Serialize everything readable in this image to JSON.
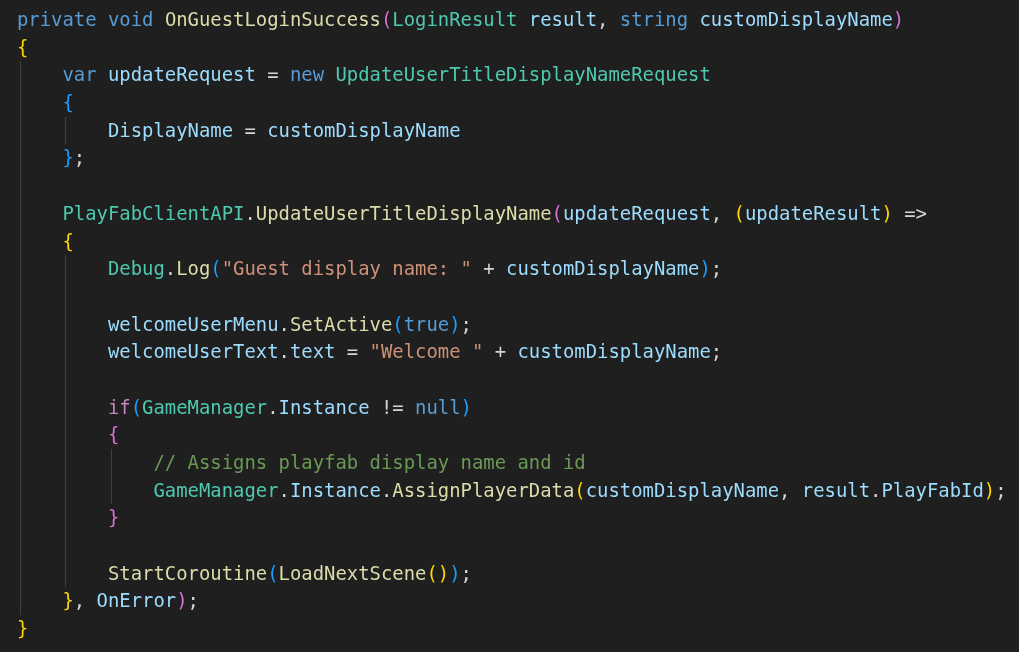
{
  "editor": {
    "lines": [
      {
        "kind": "code",
        "tokens": [
          {
            "text": "private ",
            "kind": "keyword"
          },
          {
            "text": "void ",
            "kind": "keyword"
          },
          {
            "text": "OnGuestLoginSuccess",
            "kind": "function"
          },
          {
            "text": "(",
            "kind": "bracket",
            "color": "#da70d6"
          },
          {
            "text": "LoginResult ",
            "kind": "type"
          },
          {
            "text": "result",
            "kind": "variable"
          },
          {
            "text": ", ",
            "kind": "punct"
          },
          {
            "text": "string ",
            "kind": "keyword"
          },
          {
            "text": "customDisplayName",
            "kind": "variable"
          },
          {
            "text": ")",
            "kind": "bracket",
            "color": "#da70d6"
          }
        ]
      },
      {
        "kind": "code",
        "tokens": [
          {
            "text": "{",
            "kind": "bracket",
            "color": "#ffd700"
          }
        ],
        "children": [
          {
            "kind": "code",
            "tokens": [
              {
                "text": "var ",
                "kind": "keyword"
              },
              {
                "text": "updateRequest",
                "kind": "variable"
              },
              {
                "text": " = ",
                "kind": "punct"
              },
              {
                "text": "new ",
                "kind": "keyword"
              },
              {
                "text": "UpdateUserTitleDisplayNameRequest",
                "kind": "type"
              }
            ]
          },
          {
            "kind": "code",
            "tokens": [
              {
                "text": "{",
                "kind": "bracket",
                "color": "#179fff"
              }
            ],
            "children": [
              {
                "kind": "code",
                "tokens": [
                  {
                    "text": "DisplayName",
                    "kind": "variable"
                  },
                  {
                    "text": " = ",
                    "kind": "punct"
                  },
                  {
                    "text": "customDisplayName",
                    "kind": "variable"
                  }
                ]
              }
            ]
          },
          {
            "kind": "code",
            "tokens": [
              {
                "text": "}",
                "kind": "bracket",
                "color": "#179fff"
              },
              {
                "text": ";",
                "kind": "punct"
              }
            ]
          },
          {
            "kind": "blank"
          },
          {
            "kind": "code",
            "tokens": [
              {
                "text": "PlayFabClientAPI",
                "kind": "type"
              },
              {
                "text": ".",
                "kind": "punct"
              },
              {
                "text": "UpdateUserTitleDisplayName",
                "kind": "function"
              },
              {
                "text": "(",
                "kind": "bracket",
                "color": "#da70d6"
              },
              {
                "text": "updateRequest",
                "kind": "variable"
              },
              {
                "text": ", ",
                "kind": "punct"
              },
              {
                "text": "(",
                "kind": "bracket",
                "color": "#ffd700"
              },
              {
                "text": "updateResult",
                "kind": "variable"
              },
              {
                "text": ")",
                "kind": "bracket",
                "color": "#ffd700"
              },
              {
                "text": " =>",
                "kind": "punct"
              }
            ]
          },
          {
            "kind": "code",
            "tokens": [
              {
                "text": "{",
                "kind": "bracket",
                "color": "#ffd700"
              }
            ],
            "children": [
              {
                "kind": "code",
                "tokens": [
                  {
                    "text": "Debug",
                    "kind": "type"
                  },
                  {
                    "text": ".",
                    "kind": "punct"
                  },
                  {
                    "text": "Log",
                    "kind": "function"
                  },
                  {
                    "text": "(",
                    "kind": "bracket",
                    "color": "#179fff"
                  },
                  {
                    "text": "\"Guest display name: \"",
                    "kind": "string"
                  },
                  {
                    "text": " + ",
                    "kind": "punct"
                  },
                  {
                    "text": "customDisplayName",
                    "kind": "variable"
                  },
                  {
                    "text": ")",
                    "kind": "bracket",
                    "color": "#179fff"
                  },
                  {
                    "text": ";",
                    "kind": "punct"
                  }
                ]
              },
              {
                "kind": "blank"
              },
              {
                "kind": "code",
                "tokens": [
                  {
                    "text": "welcomeUserMenu",
                    "kind": "variable"
                  },
                  {
                    "text": ".",
                    "kind": "punct"
                  },
                  {
                    "text": "SetActive",
                    "kind": "function"
                  },
                  {
                    "text": "(",
                    "kind": "bracket",
                    "color": "#179fff"
                  },
                  {
                    "text": "true",
                    "kind": "keyword"
                  },
                  {
                    "text": ")",
                    "kind": "bracket",
                    "color": "#179fff"
                  },
                  {
                    "text": ";",
                    "kind": "punct"
                  }
                ]
              },
              {
                "kind": "code",
                "tokens": [
                  {
                    "text": "welcomeUserText",
                    "kind": "variable"
                  },
                  {
                    "text": ".",
                    "kind": "punct"
                  },
                  {
                    "text": "text",
                    "kind": "variable"
                  },
                  {
                    "text": " = ",
                    "kind": "punct"
                  },
                  {
                    "text": "\"Welcome \"",
                    "kind": "string"
                  },
                  {
                    "text": " + ",
                    "kind": "punct"
                  },
                  {
                    "text": "customDisplayName",
                    "kind": "variable"
                  },
                  {
                    "text": ";",
                    "kind": "punct"
                  }
                ]
              },
              {
                "kind": "blank"
              },
              {
                "kind": "code",
                "tokens": [
                  {
                    "text": "if",
                    "kind": "control"
                  },
                  {
                    "text": "(",
                    "kind": "bracket",
                    "color": "#179fff"
                  },
                  {
                    "text": "GameManager",
                    "kind": "type"
                  },
                  {
                    "text": ".",
                    "kind": "punct"
                  },
                  {
                    "text": "Instance",
                    "kind": "variable"
                  },
                  {
                    "text": " != ",
                    "kind": "punct"
                  },
                  {
                    "text": "null",
                    "kind": "keyword"
                  },
                  {
                    "text": ")",
                    "kind": "bracket",
                    "color": "#179fff"
                  }
                ]
              },
              {
                "kind": "code",
                "tokens": [
                  {
                    "text": "{",
                    "kind": "bracket",
                    "color": "#da70d6"
                  }
                ],
                "children": [
                  {
                    "kind": "code",
                    "tokens": [
                      {
                        "text": "// Assigns playfab display name and id",
                        "kind": "comment"
                      }
                    ]
                  },
                  {
                    "kind": "code",
                    "tokens": [
                      {
                        "text": "GameManager",
                        "kind": "type"
                      },
                      {
                        "text": ".",
                        "kind": "punct"
                      },
                      {
                        "text": "Instance",
                        "kind": "variable"
                      },
                      {
                        "text": ".",
                        "kind": "punct"
                      },
                      {
                        "text": "AssignPlayerData",
                        "kind": "function"
                      },
                      {
                        "text": "(",
                        "kind": "bracket",
                        "color": "#ffd700"
                      },
                      {
                        "text": "customDisplayName",
                        "kind": "variable"
                      },
                      {
                        "text": ", ",
                        "kind": "punct"
                      },
                      {
                        "text": "result",
                        "kind": "variable"
                      },
                      {
                        "text": ".",
                        "kind": "punct"
                      },
                      {
                        "text": "PlayFabId",
                        "kind": "variable"
                      },
                      {
                        "text": ")",
                        "kind": "bracket",
                        "color": "#ffd700"
                      },
                      {
                        "text": ";",
                        "kind": "punct"
                      }
                    ]
                  }
                ]
              },
              {
                "kind": "code",
                "tokens": [
                  {
                    "text": "}",
                    "kind": "bracket",
                    "color": "#da70d6"
                  }
                ]
              },
              {
                "kind": "blank"
              },
              {
                "kind": "code",
                "tokens": [
                  {
                    "text": "StartCoroutine",
                    "kind": "function"
                  },
                  {
                    "text": "(",
                    "kind": "bracket",
                    "color": "#179fff"
                  },
                  {
                    "text": "LoadNextScene",
                    "kind": "function"
                  },
                  {
                    "text": "(",
                    "kind": "bracket",
                    "color": "#ffd700"
                  },
                  {
                    "text": ")",
                    "kind": "bracket",
                    "color": "#ffd700"
                  },
                  {
                    "text": ")",
                    "kind": "bracket",
                    "color": "#179fff"
                  },
                  {
                    "text": ";",
                    "kind": "punct"
                  }
                ]
              }
            ]
          },
          {
            "kind": "code",
            "tokens": [
              {
                "text": "}",
                "kind": "bracket",
                "color": "#ffd700"
              },
              {
                "text": ", ",
                "kind": "punct"
              },
              {
                "text": "OnError",
                "kind": "variable"
              },
              {
                "text": ")",
                "kind": "bracket",
                "color": "#da70d6"
              },
              {
                "text": ";",
                "kind": "punct"
              }
            ]
          }
        ]
      },
      {
        "kind": "code",
        "tokens": [
          {
            "text": "}",
            "kind": "bracket",
            "color": "#ffd700"
          }
        ]
      }
    ]
  }
}
